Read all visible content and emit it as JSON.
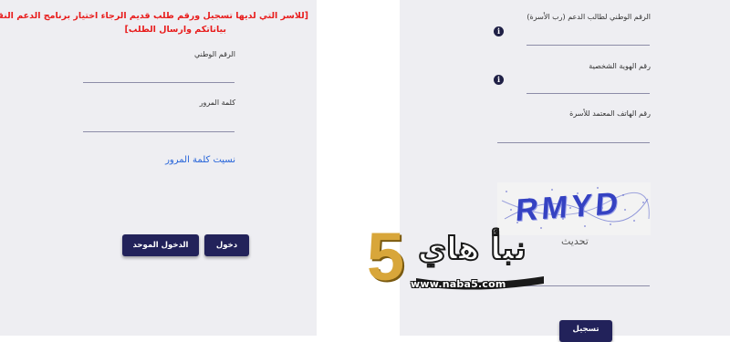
{
  "login": {
    "notice_line1": "[للاسر التي لديها تسجيل ورقم طلب قديم الرجاء اختيار برنامج الدعم النقدي وتعبئة",
    "notice_line2": "بياناتكم وارسال الطلب]",
    "national_id_label": "الرقم الوطني",
    "password_label": "كلمة المرور",
    "forgot_password": "نسيت كلمة المرور",
    "login_button": "دخول",
    "unified_login_button": "الدخول الموحد"
  },
  "register": {
    "applicant_id_label": "الرقم الوطني لطالب الدعم (رب الأسرة)",
    "personal_id_label": "رقم الهوية الشخصية",
    "phone_label": "رقم الهاتف المعتمد للأسرة",
    "captcha_text": "RMYD",
    "refresh_label": "تحديث",
    "register_button": "تسجيل"
  },
  "watermark": {
    "logo_text": "نبأ هاي",
    "logo_digit": "5",
    "url": "www.naba5.com"
  }
}
